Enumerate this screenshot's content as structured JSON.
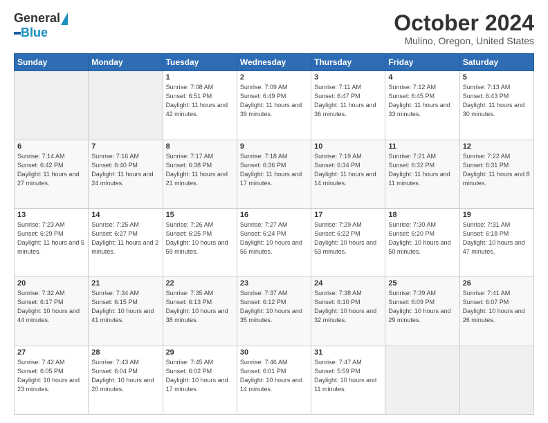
{
  "logo": {
    "general": "General",
    "blue": "Blue"
  },
  "header": {
    "month": "October 2024",
    "location": "Mulino, Oregon, United States"
  },
  "days_of_week": [
    "Sunday",
    "Monday",
    "Tuesday",
    "Wednesday",
    "Thursday",
    "Friday",
    "Saturday"
  ],
  "weeks": [
    [
      {
        "day": "",
        "sunrise": "",
        "sunset": "",
        "daylight": ""
      },
      {
        "day": "",
        "sunrise": "",
        "sunset": "",
        "daylight": ""
      },
      {
        "day": "1",
        "sunrise": "Sunrise: 7:08 AM",
        "sunset": "Sunset: 6:51 PM",
        "daylight": "Daylight: 11 hours and 42 minutes."
      },
      {
        "day": "2",
        "sunrise": "Sunrise: 7:09 AM",
        "sunset": "Sunset: 6:49 PM",
        "daylight": "Daylight: 11 hours and 39 minutes."
      },
      {
        "day": "3",
        "sunrise": "Sunrise: 7:11 AM",
        "sunset": "Sunset: 6:47 PM",
        "daylight": "Daylight: 11 hours and 36 minutes."
      },
      {
        "day": "4",
        "sunrise": "Sunrise: 7:12 AM",
        "sunset": "Sunset: 6:45 PM",
        "daylight": "Daylight: 11 hours and 33 minutes."
      },
      {
        "day": "5",
        "sunrise": "Sunrise: 7:13 AM",
        "sunset": "Sunset: 6:43 PM",
        "daylight": "Daylight: 11 hours and 30 minutes."
      }
    ],
    [
      {
        "day": "6",
        "sunrise": "Sunrise: 7:14 AM",
        "sunset": "Sunset: 6:42 PM",
        "daylight": "Daylight: 11 hours and 27 minutes."
      },
      {
        "day": "7",
        "sunrise": "Sunrise: 7:16 AM",
        "sunset": "Sunset: 6:40 PM",
        "daylight": "Daylight: 11 hours and 24 minutes."
      },
      {
        "day": "8",
        "sunrise": "Sunrise: 7:17 AM",
        "sunset": "Sunset: 6:38 PM",
        "daylight": "Daylight: 11 hours and 21 minutes."
      },
      {
        "day": "9",
        "sunrise": "Sunrise: 7:18 AM",
        "sunset": "Sunset: 6:36 PM",
        "daylight": "Daylight: 11 hours and 17 minutes."
      },
      {
        "day": "10",
        "sunrise": "Sunrise: 7:19 AM",
        "sunset": "Sunset: 6:34 PM",
        "daylight": "Daylight: 11 hours and 14 minutes."
      },
      {
        "day": "11",
        "sunrise": "Sunrise: 7:21 AM",
        "sunset": "Sunset: 6:32 PM",
        "daylight": "Daylight: 11 hours and 11 minutes."
      },
      {
        "day": "12",
        "sunrise": "Sunrise: 7:22 AM",
        "sunset": "Sunset: 6:31 PM",
        "daylight": "Daylight: 11 hours and 8 minutes."
      }
    ],
    [
      {
        "day": "13",
        "sunrise": "Sunrise: 7:23 AM",
        "sunset": "Sunset: 6:29 PM",
        "daylight": "Daylight: 11 hours and 5 minutes."
      },
      {
        "day": "14",
        "sunrise": "Sunrise: 7:25 AM",
        "sunset": "Sunset: 6:27 PM",
        "daylight": "Daylight: 11 hours and 2 minutes."
      },
      {
        "day": "15",
        "sunrise": "Sunrise: 7:26 AM",
        "sunset": "Sunset: 6:25 PM",
        "daylight": "Daylight: 10 hours and 59 minutes."
      },
      {
        "day": "16",
        "sunrise": "Sunrise: 7:27 AM",
        "sunset": "Sunset: 6:24 PM",
        "daylight": "Daylight: 10 hours and 56 minutes."
      },
      {
        "day": "17",
        "sunrise": "Sunrise: 7:29 AM",
        "sunset": "Sunset: 6:22 PM",
        "daylight": "Daylight: 10 hours and 53 minutes."
      },
      {
        "day": "18",
        "sunrise": "Sunrise: 7:30 AM",
        "sunset": "Sunset: 6:20 PM",
        "daylight": "Daylight: 10 hours and 50 minutes."
      },
      {
        "day": "19",
        "sunrise": "Sunrise: 7:31 AM",
        "sunset": "Sunset: 6:18 PM",
        "daylight": "Daylight: 10 hours and 47 minutes."
      }
    ],
    [
      {
        "day": "20",
        "sunrise": "Sunrise: 7:32 AM",
        "sunset": "Sunset: 6:17 PM",
        "daylight": "Daylight: 10 hours and 44 minutes."
      },
      {
        "day": "21",
        "sunrise": "Sunrise: 7:34 AM",
        "sunset": "Sunset: 6:15 PM",
        "daylight": "Daylight: 10 hours and 41 minutes."
      },
      {
        "day": "22",
        "sunrise": "Sunrise: 7:35 AM",
        "sunset": "Sunset: 6:13 PM",
        "daylight": "Daylight: 10 hours and 38 minutes."
      },
      {
        "day": "23",
        "sunrise": "Sunrise: 7:37 AM",
        "sunset": "Sunset: 6:12 PM",
        "daylight": "Daylight: 10 hours and 35 minutes."
      },
      {
        "day": "24",
        "sunrise": "Sunrise: 7:38 AM",
        "sunset": "Sunset: 6:10 PM",
        "daylight": "Daylight: 10 hours and 32 minutes."
      },
      {
        "day": "25",
        "sunrise": "Sunrise: 7:39 AM",
        "sunset": "Sunset: 6:09 PM",
        "daylight": "Daylight: 10 hours and 29 minutes."
      },
      {
        "day": "26",
        "sunrise": "Sunrise: 7:41 AM",
        "sunset": "Sunset: 6:07 PM",
        "daylight": "Daylight: 10 hours and 26 minutes."
      }
    ],
    [
      {
        "day": "27",
        "sunrise": "Sunrise: 7:42 AM",
        "sunset": "Sunset: 6:05 PM",
        "daylight": "Daylight: 10 hours and 23 minutes."
      },
      {
        "day": "28",
        "sunrise": "Sunrise: 7:43 AM",
        "sunset": "Sunset: 6:04 PM",
        "daylight": "Daylight: 10 hours and 20 minutes."
      },
      {
        "day": "29",
        "sunrise": "Sunrise: 7:45 AM",
        "sunset": "Sunset: 6:02 PM",
        "daylight": "Daylight: 10 hours and 17 minutes."
      },
      {
        "day": "30",
        "sunrise": "Sunrise: 7:46 AM",
        "sunset": "Sunset: 6:01 PM",
        "daylight": "Daylight: 10 hours and 14 minutes."
      },
      {
        "day": "31",
        "sunrise": "Sunrise: 7:47 AM",
        "sunset": "Sunset: 5:59 PM",
        "daylight": "Daylight: 10 hours and 11 minutes."
      },
      {
        "day": "",
        "sunrise": "",
        "sunset": "",
        "daylight": ""
      },
      {
        "day": "",
        "sunrise": "",
        "sunset": "",
        "daylight": ""
      }
    ]
  ]
}
